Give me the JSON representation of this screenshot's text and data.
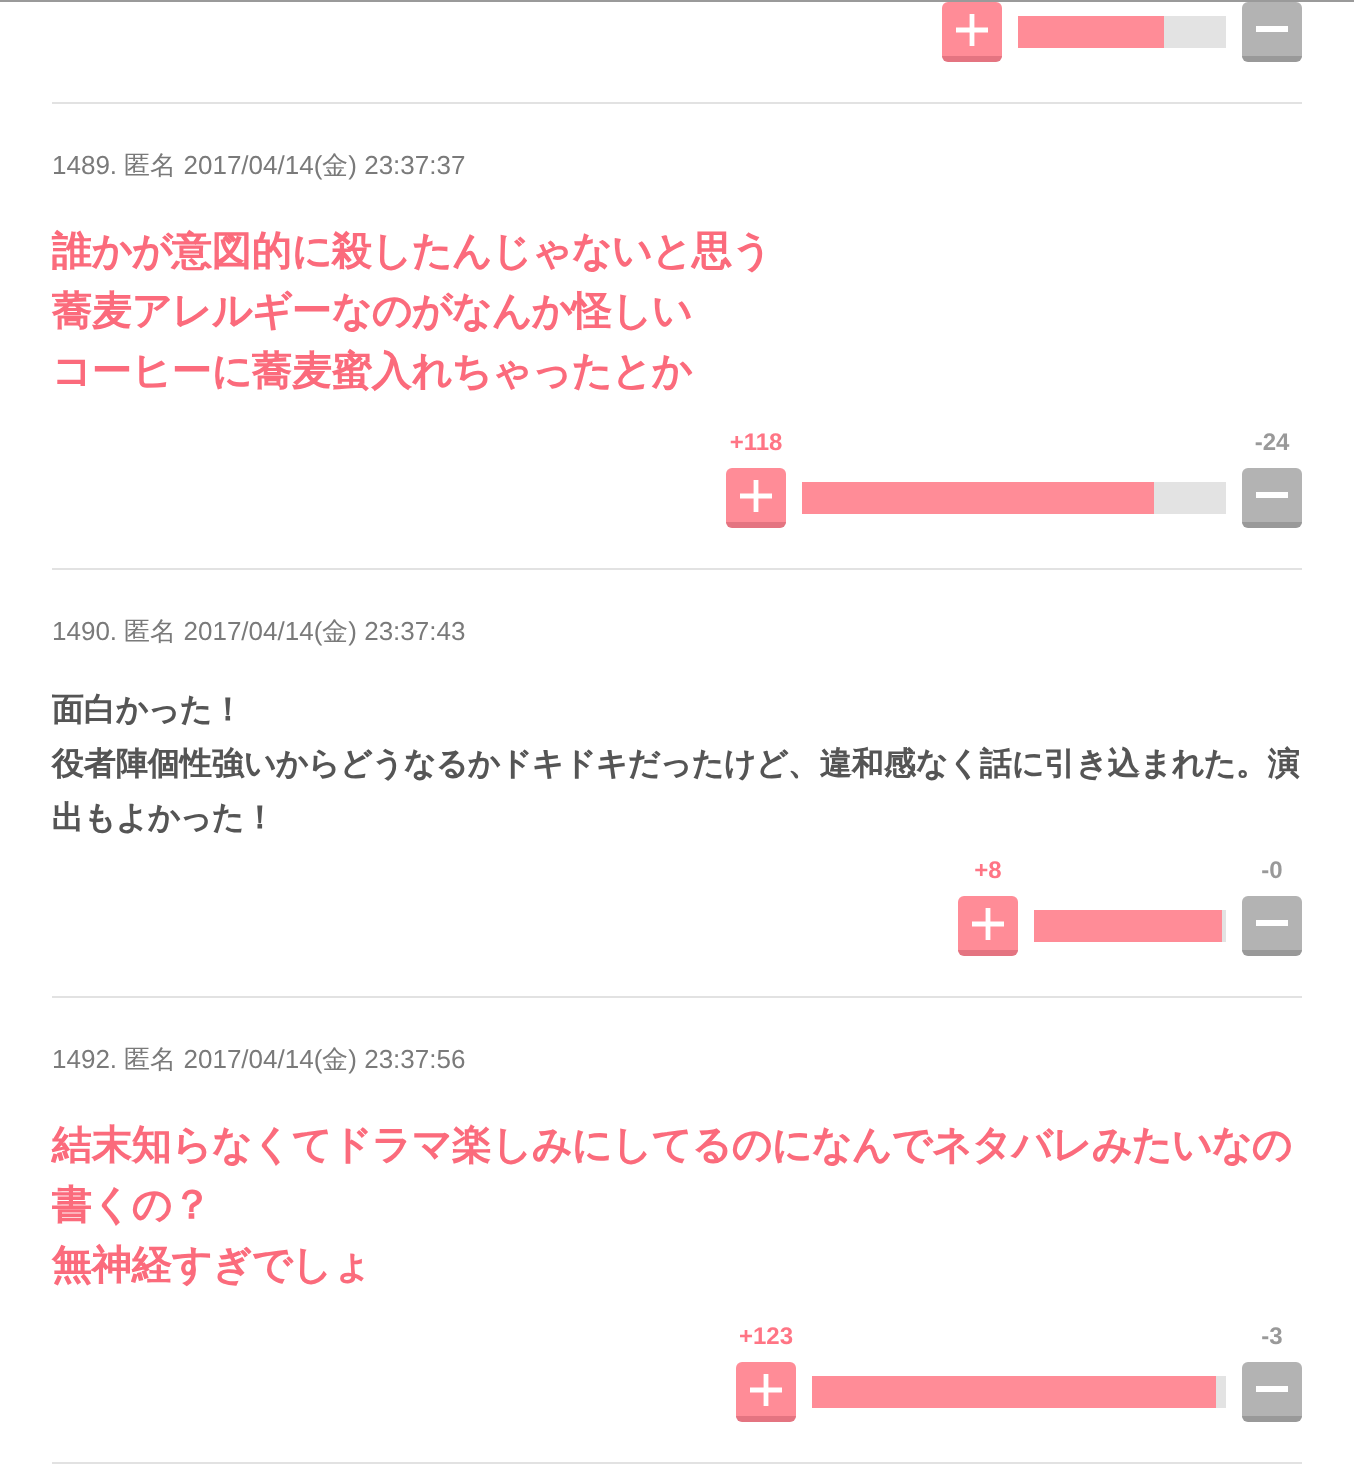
{
  "comments": [
    {
      "vote": {
        "level": 0.7
      }
    },
    {
      "meta": "1489. 匿名 2017/04/14(金) 23:37:37",
      "kind": "highlight",
      "lines": [
        "誰かが意図的に殺したんじゃないと思う",
        "蕎麦アレルギーなのがなんか怪しい",
        "コーヒーに蕎麦蜜入れちゃったとか"
      ],
      "vote": {
        "plus": "+118",
        "minus": "-24",
        "level": 0.83
      }
    },
    {
      "meta": "1490. 匿名 2017/04/14(金) 23:37:43",
      "kind": "plain",
      "lines": [
        "面白かった！",
        "役者陣個性強いからどうなるかドキドキだったけど、違和感なく話に引き込まれた。演出もよかった！"
      ],
      "vote": {
        "plus": "+8",
        "minus": "-0",
        "level": 0.98
      }
    },
    {
      "meta": "1492. 匿名 2017/04/14(金) 23:37:56",
      "kind": "highlight",
      "lines": [
        "結末知らなくてドラマ楽しみにしてるのになんでネタバレみたいなの書くの？",
        "無神経すぎでしょ"
      ],
      "vote": {
        "plus": "+123",
        "minus": "-3",
        "level": 0.976
      }
    }
  ]
}
